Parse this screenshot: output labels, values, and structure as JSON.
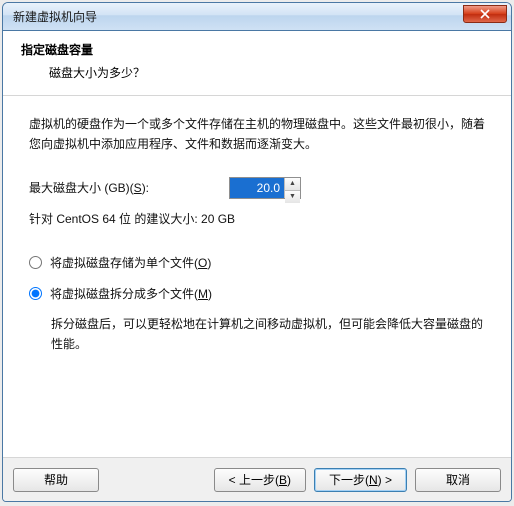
{
  "titlebar": {
    "title": "新建虚拟机向导"
  },
  "header": {
    "title": "指定磁盘容量",
    "subtitle": "磁盘大小为多少？"
  },
  "content": {
    "description": "虚拟机的硬盘作为一个或多个文件存储在主机的物理磁盘中。这些文件最初很小，随着您向虚拟机中添加应用程序、文件和数据而逐渐变大。",
    "size_label_before": "最大磁盘大小 (GB)(",
    "size_accel": "S",
    "size_label_after": "):",
    "size_value": "20.0",
    "recommend": "针对 CentOS 64 位 的建议大小: 20 GB",
    "opt_single_before": "将虚拟磁盘存储为单个文件(",
    "opt_single_accel": "O",
    "opt_single_after": ")",
    "opt_split_before": "将虚拟磁盘拆分成多个文件(",
    "opt_split_accel": "M",
    "opt_split_after": ")",
    "opt_split_desc": "拆分磁盘后，可以更轻松地在计算机之间移动虚拟机，但可能会降低大容量磁盘的性能。"
  },
  "footer": {
    "help": "帮助",
    "back_before": "< 上一步(",
    "back_accel": "B",
    "back_after": ")",
    "next_before": "下一步(",
    "next_accel": "N",
    "next_after": ") >",
    "cancel": "取消"
  }
}
